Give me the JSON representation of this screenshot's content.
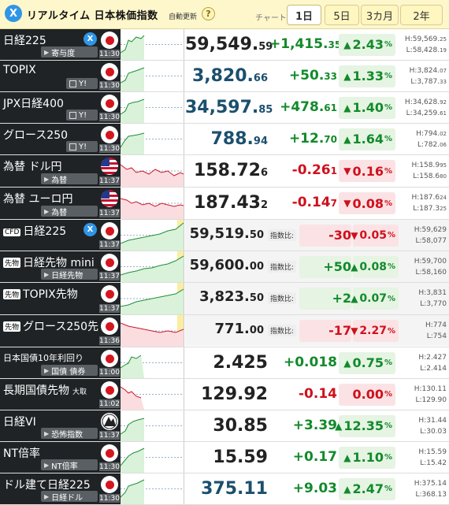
{
  "header": {
    "x_label": "X",
    "title": "リアルタイム 日本株価指数",
    "subtitle": "自動更新",
    "help": "?",
    "chart_label": "チャート:",
    "tabs": [
      "1日",
      "5日",
      "3カ月",
      "2年"
    ],
    "active_tab": "1日"
  },
  "rows": [
    {
      "name": "日経225",
      "sub": "寄与度",
      "time": "11:30",
      "flag": "jp",
      "price_int": "59,549.",
      "price_dec": "59",
      "change_int": "+1,415.",
      "change_dec": "35",
      "pct": "2.43",
      "pct_dir": "up",
      "high": "H:59,569.",
      "high_dec": "25",
      "low": "L:58,428.",
      "low_dec": "19",
      "price_color": "#222"
    },
    {
      "name": "TOPIX",
      "sub": "Y!",
      "time": "11:30",
      "flag": "jp",
      "price_int": "3,820.",
      "price_dec": "66",
      "change_int": "+50.",
      "change_dec": "33",
      "pct": "1.33",
      "pct_dir": "up",
      "high": "H:3,824.",
      "high_dec": "07",
      "low": "L:3,787.",
      "low_dec": "33",
      "price_color": "#1b4f6e"
    },
    {
      "name": "JPX日経400",
      "sub": "Y!",
      "time": "11:30",
      "flag": "jp",
      "price_int": "34,597.",
      "price_dec": "85",
      "change_int": "+478.",
      "change_dec": "61",
      "pct": "1.40",
      "pct_dir": "up",
      "high": "H:34,628.",
      "high_dec": "92",
      "low": "L:34,259.",
      "low_dec": "61",
      "price_color": "#1b4f6e"
    },
    {
      "name": "グロース250",
      "sub": "Y!",
      "time": "11:30",
      "flag": "jp",
      "price_int": "788.",
      "price_dec": "94",
      "change_int": "+12.",
      "change_dec": "70",
      "pct": "1.64",
      "pct_dir": "up",
      "high": "H:794.",
      "high_dec": "02",
      "low": "L:782.",
      "low_dec": "06",
      "price_color": "#1b4f6e"
    },
    {
      "name": "為替 ドル円",
      "sub": "為替",
      "time": "11:37",
      "flag": "us",
      "price_int": "158.72",
      "price_dec": "6",
      "change_int": "-0.26",
      "change_dec": "1",
      "pct": "0.16",
      "pct_dir": "dn",
      "high": "H:158.9",
      "high_dec": "95",
      "low": "L:158.6",
      "low_dec": "80",
      "price_color": "#222"
    },
    {
      "name": "為替 ユーロ円",
      "sub": "為替",
      "time": "11:37",
      "flag": "us",
      "price_int": "187.43",
      "price_dec": "2",
      "change_int": "-0.14",
      "change_dec": "7",
      "pct": "0.08",
      "pct_dir": "dn",
      "high": "H:187.6",
      "high_dec": "24",
      "low": "L:187.3",
      "low_dec": "25",
      "price_color": "#222"
    },
    {
      "name": "日経225",
      "badge": "CFD",
      "sub": "",
      "time": "11:37",
      "flag": "jp",
      "price_int": "59,519.",
      "price_dec": "50",
      "idx_label": "指数比:",
      "change_int": "-30",
      "change_dec": "",
      "pct": "0.05",
      "pct_dir": "dn",
      "high": "H:59,629",
      "high_dec": "",
      "low": "L:58,077",
      "low_dec": "",
      "price_color": "#222"
    },
    {
      "name": "日経先物 mini",
      "badge": "先物",
      "sub": "日経先物",
      "time": "11:37",
      "flag": "jp",
      "price_int": "59,600.",
      "price_dec": "00",
      "idx_label": "指数比:",
      "change_int": "+50",
      "change_dec": "",
      "pct": "0.08",
      "pct_dir": "up",
      "high": "H:59,700",
      "high_dec": "",
      "low": "L:58,160",
      "low_dec": "",
      "price_color": "#222"
    },
    {
      "name": "TOPIX先物",
      "badge": "先物",
      "sub": "",
      "time": "11:37",
      "flag": "jp",
      "price_int": "3,823.",
      "price_dec": "50",
      "idx_label": "指数比:",
      "change_int": "+2",
      "change_dec": "",
      "pct": "0.07",
      "pct_dir": "up",
      "high": "H:3,831",
      "high_dec": "",
      "low": "L:3,770",
      "low_dec": "",
      "price_color": "#222"
    },
    {
      "name": "グロース250先物",
      "badge": "先物",
      "sub": "",
      "time": "11:36",
      "flag": "jp",
      "price_int": "771.",
      "price_dec": "00",
      "idx_label": "指数比:",
      "change_int": "-17",
      "change_dec": "",
      "pct": "2.27",
      "pct_dir": "dn",
      "high": "H:774",
      "high_dec": "",
      "low": "L:754",
      "low_dec": "",
      "price_color": "#222"
    },
    {
      "name": "日本国債10年利回り",
      "sub": "国債 債券",
      "time": "11:00",
      "flag": "jp",
      "price_int": "2.425",
      "price_dec": "",
      "change_int": "+0.018",
      "change_dec": "",
      "pct": "0.75",
      "pct_dir": "up",
      "high": "H:2.427",
      "high_dec": "",
      "low": "L:2.414",
      "low_dec": "",
      "price_color": "#222"
    },
    {
      "name": "長期国債先物",
      "name_extra": "大取",
      "sub": "",
      "time": "11:02",
      "flag": "jp",
      "price_int": "129.92",
      "price_dec": "",
      "change_int": "-0.14",
      "change_dec": "",
      "pct": "0.00",
      "pct_dir": "flat",
      "high": "H:130.11",
      "high_dec": "",
      "low": "L:129.90",
      "low_dec": "",
      "price_color": "#222"
    },
    {
      "name": "日経VI",
      "sub": "恐怖指数",
      "time": "11:37",
      "flag": "vix",
      "price_int": "30.85",
      "price_dec": "",
      "change_int": "+3.39",
      "change_dec": "",
      "pct": "12.35",
      "pct_dir": "up",
      "high": "H:31.44",
      "high_dec": "",
      "low": "L:30.03",
      "low_dec": "",
      "price_color": "#222"
    },
    {
      "name": "NT倍率",
      "sub": "NT倍率",
      "time": "11:30",
      "flag": "jp",
      "price_int": "15.59",
      "price_dec": "",
      "change_int": "+0.17",
      "change_dec": "",
      "pct": "1.10",
      "pct_dir": "up",
      "high": "H:15.59",
      "high_dec": "",
      "low": "L:15.42",
      "low_dec": "",
      "price_color": "#222"
    },
    {
      "name": "ドル建て日経225",
      "sub": "日経ドル",
      "time": "11:30",
      "flag": "jp",
      "price_int": "375.11",
      "price_dec": "",
      "change_int": "+9.03",
      "change_dec": "",
      "pct": "2.47",
      "pct_dir": "up",
      "high": "H:375.14",
      "high_dec": "",
      "low": "L:368.13",
      "low_dec": "",
      "price_color": "#1b4f6e"
    }
  ]
}
